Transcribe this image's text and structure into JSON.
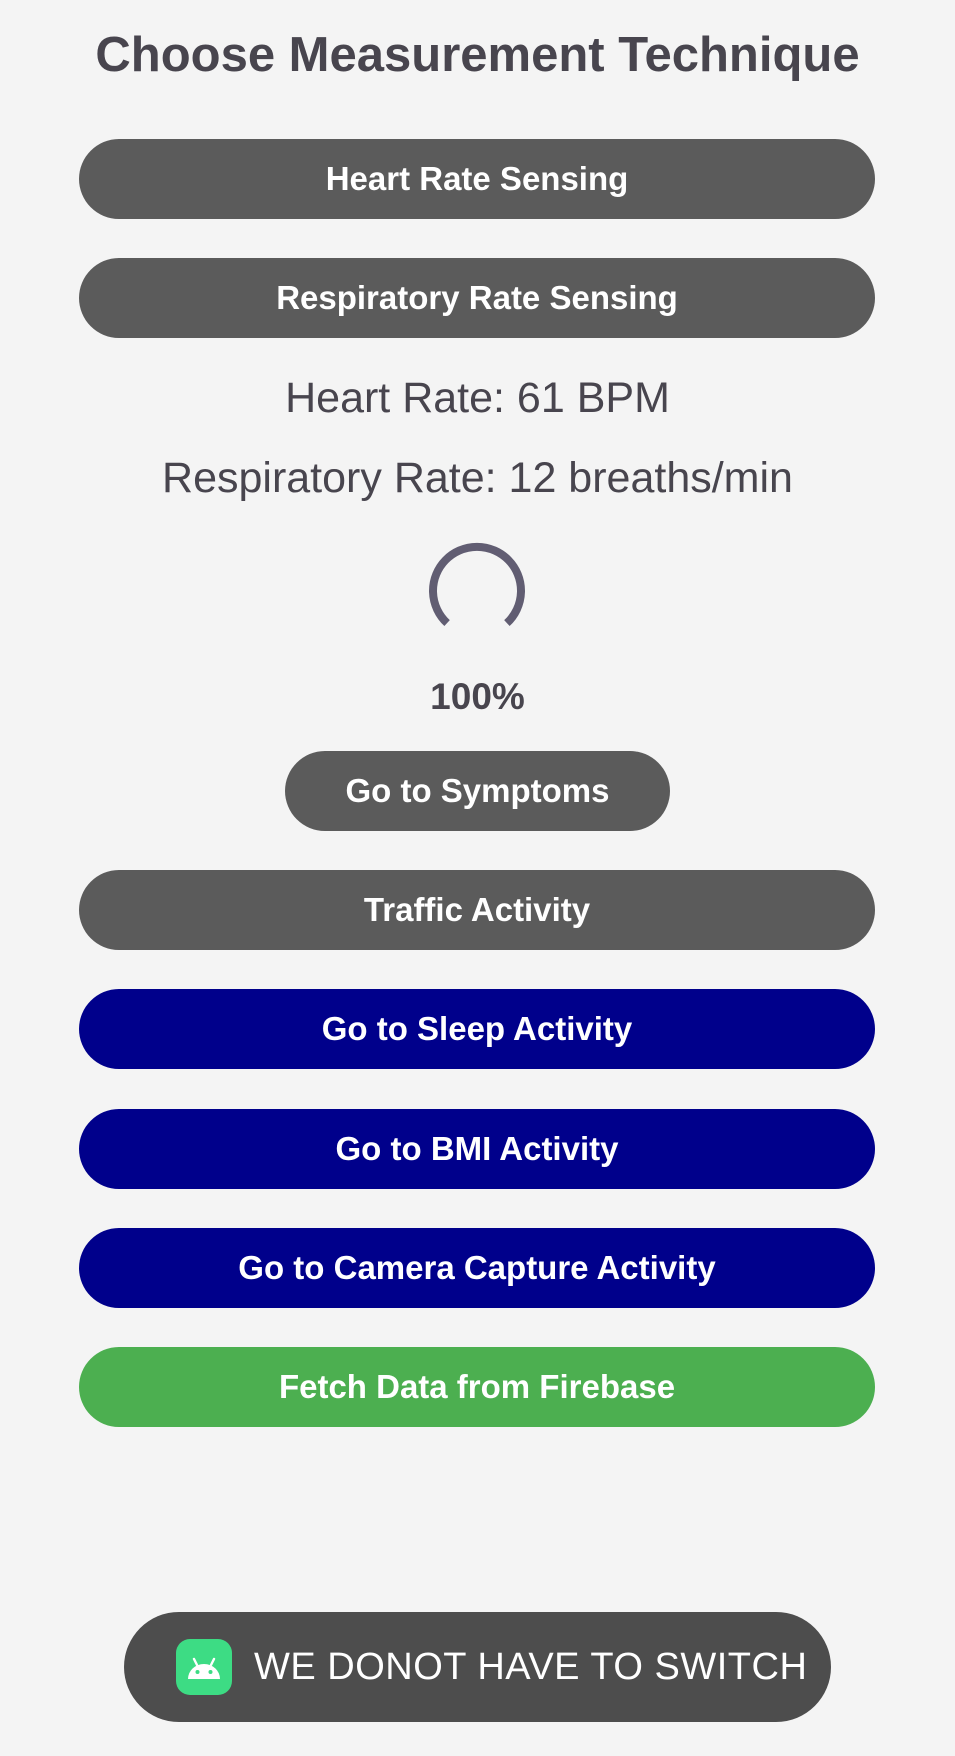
{
  "header": {
    "title": "Choose Measurement Technique"
  },
  "buttons": {
    "heart_rate_sensing": "Heart Rate Sensing",
    "respiratory_rate_sensing": "Respiratory Rate Sensing",
    "go_to_symptoms": "Go to Symptoms",
    "traffic_activity": "Traffic Activity",
    "go_to_sleep_activity": "Go to Sleep Activity",
    "go_to_bmi_activity": "Go to BMI Activity",
    "go_to_camera_capture_activity": "Go to Camera Capture Activity",
    "fetch_data_from_firebase": "Fetch Data from Firebase"
  },
  "readings": {
    "heart_rate": "Heart Rate: 61 BPM",
    "respiratory_rate": "Respiratory Rate: 12 breaths/min"
  },
  "progress": {
    "label": "100%",
    "value": 1.0,
    "indicator_icon": "circular-progress-icon"
  },
  "toast": {
    "icon": "android-icon",
    "text": "WE DONOT HAVE TO SWITCH"
  },
  "colors": {
    "background": "#f4f4f4",
    "button_gray": "#5b5b5b",
    "button_navy": "#00008b",
    "button_green": "#4caf50",
    "text_dark": "#48454e",
    "toast_background": "#4d4d4d",
    "android_green": "#3ddc84"
  }
}
